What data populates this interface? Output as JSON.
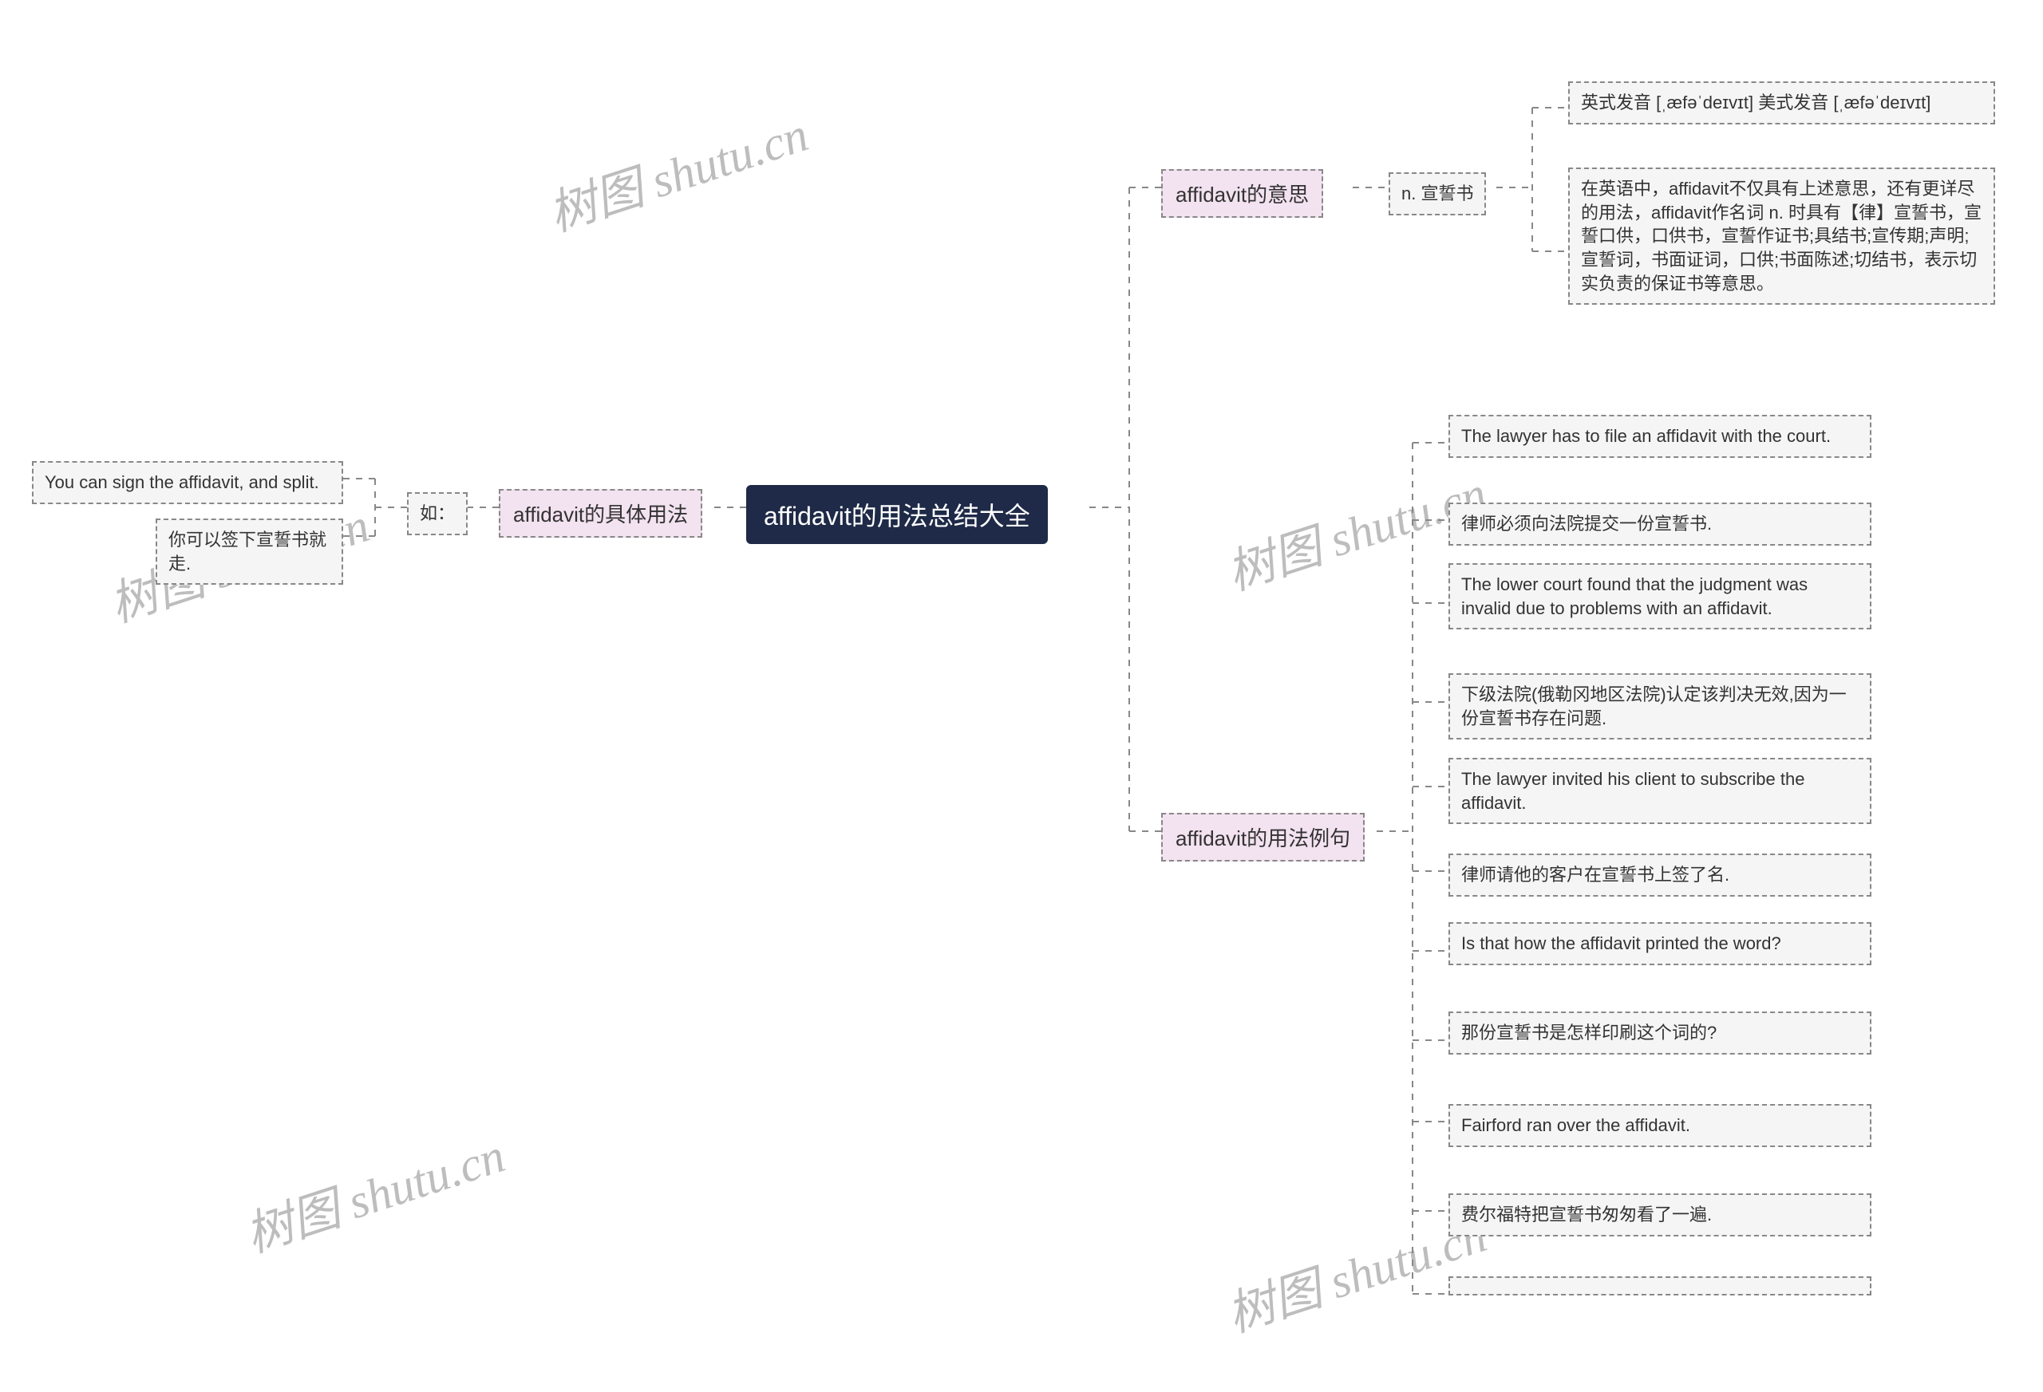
{
  "root": {
    "title": "affidavit的用法总结大全"
  },
  "branches": {
    "meaning": {
      "label": "affidavit的意思",
      "sub": "n. 宣誓书",
      "leaves": [
        "英式发音 [ˌæfəˈdeɪvɪt] 美式发音 [ˌæfəˈdeɪvɪt]",
        "在英语中，affidavit不仅具有上述意思，还有更详尽的用法，affidavit作名词 n. 时具有【律】宣誓书，宣誓口供，口供书，宣誓作证书;具结书;宣传期;声明;宣誓词，书面证词，口供;书面陈述;切结书，表示切实负责的保证书等意思。"
      ]
    },
    "examples": {
      "label": "affidavit的用法例句",
      "leaves": [
        "The lawyer has to file an affidavit with the court.",
        "律师必须向法院提交一份宣誓书.",
        "The lower court found that the judgment was invalid due to problems with an affidavit.",
        "下级法院(俄勒冈地区法院)认定该判决无效,因为一份宣誓书存在问题.",
        "The lawyer invited his client to subscribe the affidavit.",
        "律师请他的客户在宣誓书上签了名.",
        "Is that how the affidavit printed the word?",
        "那份宣誓书是怎样印刷这个词的?",
        "Fairford ran over the affidavit.",
        "费尔福特把宣誓书匆匆看了一遍."
      ]
    },
    "usage": {
      "label": "affidavit的具体用法",
      "sub": "如：",
      "leaves": [
        "You can sign the affidavit, and split.",
        "你可以签下宣誓书就走."
      ]
    }
  },
  "watermark": "树图 shutu.cn"
}
